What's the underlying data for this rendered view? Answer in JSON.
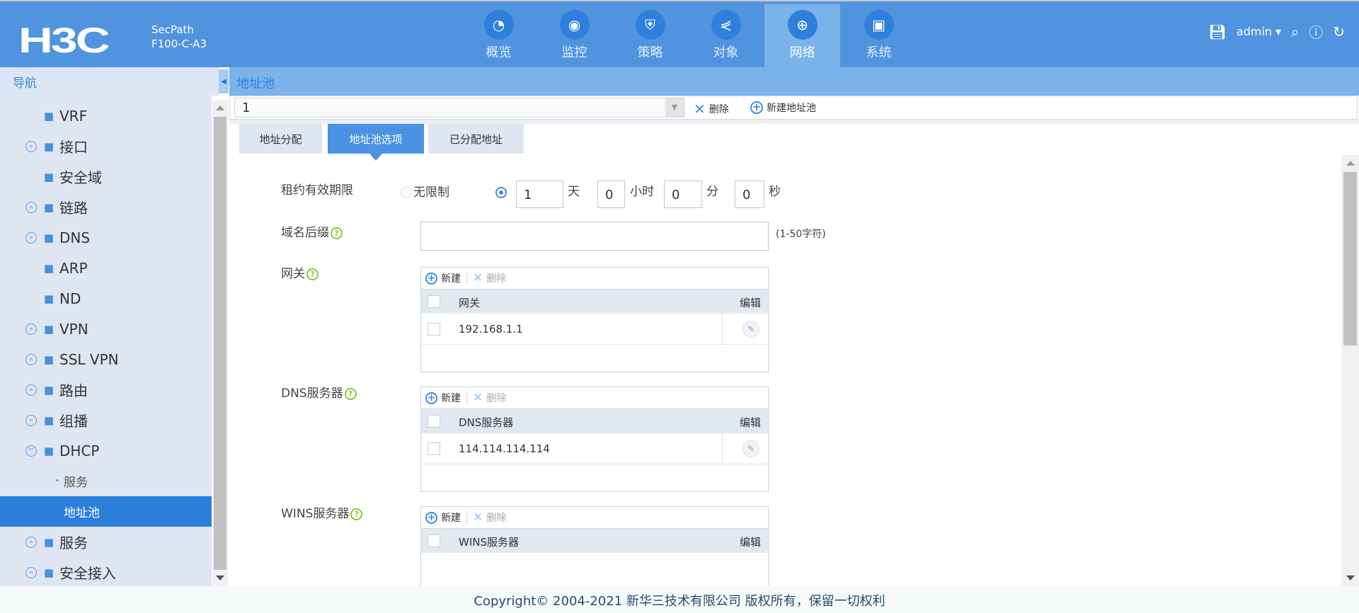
{
  "header": {
    "logo": "H3C",
    "product_line": "SecPath",
    "model": "F100-C-A3",
    "user": "admin",
    "nav": [
      {
        "label": "概览",
        "icon": "dashboard-icon"
      },
      {
        "label": "监控",
        "icon": "camera-icon"
      },
      {
        "label": "策略",
        "icon": "shield-plus-icon"
      },
      {
        "label": "对象",
        "icon": "share-icon"
      },
      {
        "label": "网络",
        "icon": "globe-icon",
        "active": true
      },
      {
        "label": "系统",
        "icon": "monitor-gear-icon"
      }
    ]
  },
  "sidebar": {
    "title": "导航",
    "items": [
      {
        "label": "VRF",
        "icon": "vrf-icon",
        "expandable": false
      },
      {
        "label": "接口",
        "icon": "interface-icon",
        "expandable": true
      },
      {
        "label": "安全域",
        "icon": "security-zone-icon",
        "expandable": false
      },
      {
        "label": "链路",
        "icon": "link-icon",
        "expandable": true
      },
      {
        "label": "DNS",
        "icon": "dns-icon",
        "expandable": true
      },
      {
        "label": "ARP",
        "icon": "arp-icon",
        "expandable": false
      },
      {
        "label": "ND",
        "icon": "nd-icon",
        "expandable": false
      },
      {
        "label": "VPN",
        "icon": "vpn-icon",
        "expandable": true
      },
      {
        "label": "SSL VPN",
        "icon": "ssl-vpn-icon",
        "expandable": true
      },
      {
        "label": "路由",
        "icon": "route-icon",
        "expandable": true
      },
      {
        "label": "组播",
        "icon": "multicast-icon",
        "expandable": true
      },
      {
        "label": "DHCP",
        "icon": "dhcp-icon",
        "expandable": true,
        "expanded": true
      },
      {
        "label": "服务",
        "sub": true
      },
      {
        "label": "地址池",
        "sub": true,
        "selected": true
      },
      {
        "label": "服务",
        "icon": "service-icon",
        "expandable": true
      },
      {
        "label": "安全接入",
        "icon": "secure-access-icon",
        "expandable": true
      }
    ]
  },
  "page": {
    "title": "地址池",
    "pool_select": "1",
    "delete_label": "删除",
    "new_pool_label": "新建地址池",
    "tabs": [
      {
        "label": "地址分配"
      },
      {
        "label": "地址池选项",
        "active": true
      },
      {
        "label": "已分配地址"
      }
    ]
  },
  "form": {
    "lease_label": "租约有效期限",
    "unlimited_label": "无限制",
    "days": "1",
    "days_unit": "天",
    "hours": "0",
    "hours_unit": "小时",
    "minutes": "0",
    "minutes_unit": "分",
    "seconds": "0",
    "seconds_unit": "秒",
    "domain_label": "域名后缀",
    "domain_value": "",
    "domain_hint": "(1-50字符)",
    "new_label": "新建",
    "delete_label": "删除",
    "edit_label": "编辑",
    "gateway": {
      "label": "网关",
      "column": "网关",
      "rows": [
        "192.168.1.1"
      ]
    },
    "dns": {
      "label": "DNS服务器",
      "column": "DNS服务器",
      "rows": [
        "114.114.114.114"
      ]
    },
    "wins": {
      "label": "WINS服务器",
      "column": "WINS服务器",
      "rows": []
    }
  },
  "footer": {
    "copyright": "Copyright© 2004-2021 新华三技术有限公司 版权所有，保留一切权利"
  }
}
